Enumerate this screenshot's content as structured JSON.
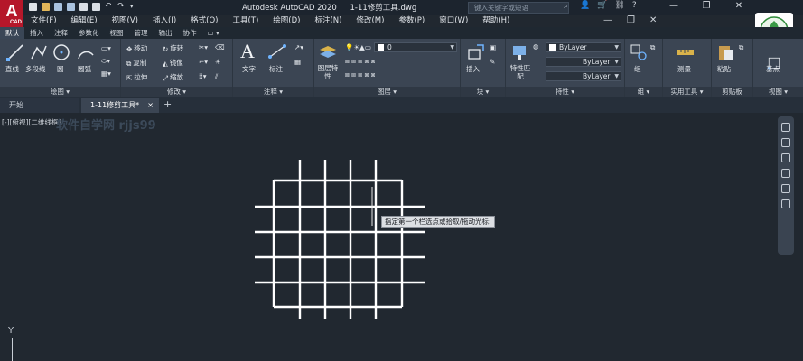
{
  "title_bar": {
    "app_logo": "A",
    "app_logo_sub": "CAD",
    "app_title": "Autodesk AutoCAD 2020",
    "file_title": "1-11修剪工具.dwg",
    "search_placeholder": "键入关键字或短语",
    "window_buttons": [
      "—",
      "❐",
      "✕"
    ]
  },
  "menu": {
    "items": [
      "文件(F)",
      "编辑(E)",
      "视图(V)",
      "插入(I)",
      "格式(O)",
      "工具(T)",
      "绘图(D)",
      "标注(N)",
      "修改(M)",
      "参数(P)",
      "窗口(W)",
      "帮助(H)"
    ],
    "right_icons": [
      "—",
      "❐",
      "✕"
    ]
  },
  "ribbon_tabs": [
    "默认",
    "插入",
    "注释",
    "参数化",
    "视图",
    "管理",
    "输出",
    "协作",
    "▭ ▾"
  ],
  "ribbon": {
    "draw": {
      "footer": "绘图 ▾",
      "tools": [
        "直线",
        "多段线",
        "圆",
        "圆弧"
      ]
    },
    "modify": {
      "footer": "修改 ▾",
      "tools": [
        "移动",
        "旋转",
        "复制",
        "镜像",
        "拉伸",
        "缩放"
      ]
    },
    "annotation": {
      "footer": "注释 ▾",
      "tools": [
        "文字",
        "标注"
      ]
    },
    "layers": {
      "footer": "图层 ▾",
      "tools": [
        "图层特性"
      ],
      "current_layer": "0"
    },
    "block": {
      "footer": "块 ▾",
      "tools": [
        "插入"
      ]
    },
    "properties": {
      "footer": "特性 ▾",
      "tools": [
        "特性匹配"
      ],
      "values": [
        "ByLayer",
        "ByLayer",
        "ByLayer"
      ]
    },
    "groups": {
      "footer": "组 ▾",
      "tools": [
        "组"
      ]
    },
    "utilities": {
      "footer": "实用工具 ▾",
      "tools": [
        "测量"
      ]
    },
    "clipboard": {
      "footer": "剪贴板",
      "tools": [
        "粘贴"
      ]
    },
    "view": {
      "footer": "视图 ▾",
      "tools": [
        "基点"
      ]
    }
  },
  "doc_tabs": {
    "start": "开始",
    "file": "1-11修剪工具*",
    "close": "×",
    "add": "+"
  },
  "canvas": {
    "view_label": "[-][俯视][二维线框]",
    "watermark": "软件自学网 rjjs99",
    "tooltip": "指定第一个栏选点或拾取/拖动光标:",
    "ucs_y_label": "Y"
  },
  "colors": {
    "background": "#212830",
    "ribbon": "#3b4553",
    "title_bar": "#1c242e",
    "grid_lines": "#ffffff",
    "accent_red": "#b5172a"
  }
}
